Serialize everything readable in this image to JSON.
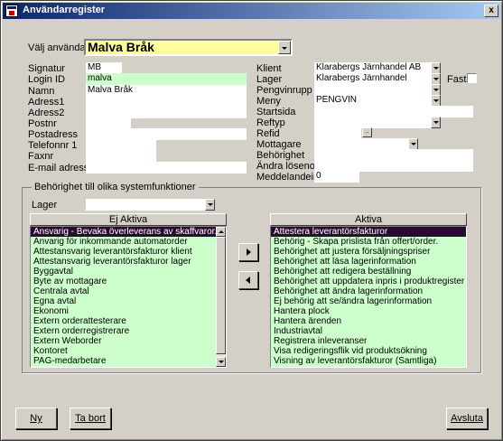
{
  "window": {
    "title": "Användarregister",
    "close_symbol": "x"
  },
  "user_select": {
    "label": "Välj användare",
    "value": "Malva Bråk"
  },
  "left_fields": [
    {
      "label": "Signatur",
      "value": "MB"
    },
    {
      "label": "Login ID",
      "value": "malva"
    },
    {
      "label": "Namn",
      "value": "Malva Bråk"
    },
    {
      "label": "Adress1",
      "value": ""
    },
    {
      "label": "Adress2",
      "value": ""
    },
    {
      "label": "Postnr",
      "value": ""
    },
    {
      "label": "Postadress",
      "value": ""
    },
    {
      "label": "Telefonnr 1",
      "value": ""
    },
    {
      "label": "Faxnr",
      "value": ""
    },
    {
      "label": "E-mail adress",
      "value": ""
    }
  ],
  "right_fields": [
    {
      "label": "Klient",
      "value": "Klarabergs Järnhandel AB"
    },
    {
      "label": "Lager",
      "value": "Klarabergs Järnhandel"
    },
    {
      "label": "Pengvinrupp",
      "value": ""
    },
    {
      "label": "Meny",
      "value": "PENGVIN"
    },
    {
      "label": "Startsida",
      "value": ""
    },
    {
      "label": "Reftyp",
      "value": ""
    },
    {
      "label": "Refid",
      "value": ""
    },
    {
      "label": "Mottagare",
      "value": ""
    },
    {
      "label": "Behörighet",
      "value": ""
    },
    {
      "label": "Ändra lösenord",
      "value": ""
    },
    {
      "label": "Meddelandeint",
      "value": "0"
    }
  ],
  "fast": {
    "label": "Fast",
    "checked": false
  },
  "refid_button": "..",
  "permissions": {
    "legend": "Behörighet till olika systemfunktioner",
    "lager_label": "Lager",
    "lager_value": "",
    "inactive_header": "Ej Aktiva",
    "active_header": "Aktiva",
    "inactive_items": [
      "Ansvarig - Bevaka överleverans av skaffvaror.",
      "Anvarig för inkommande automatorder",
      "Attestansvarig leverantörsfakturor klient",
      "Attestansvarig leverantörsfakturor lager",
      "Byggavtal",
      "Byte av mottagare",
      "Centrala avtal",
      "Egna avtal",
      "Ekonomi",
      "Extern orderattesterare",
      "Extern orderregistrerare",
      "Extern Weborder",
      "Kontoret",
      "PAG-medarbetare"
    ],
    "active_items": [
      "Attestera leverantörsfakturor",
      "Behörig - Skapa prislista från offert/order.",
      "Behörighet att justera försäljningspriser",
      "Behörighet att läsa lagerinformation",
      "Behörighet att redigera beställning",
      "Behörighet att uppdatera inpris i produktregister",
      "Behörighet att ändra lagerinformation",
      "Ej behörig att se/ändra lagerinformation",
      "Hantera plock",
      "Hantera ärenden",
      "Industriavtal",
      "Registrera inleveranser",
      "Visa redigeringsflik vid produktsökning",
      "Visning av leverantörsfakturor (Samtliga)"
    ]
  },
  "buttons": {
    "new": "Ny",
    "delete": "Ta bort",
    "exit": "Avsluta"
  },
  "colors": {
    "green_field": "#ccffcc",
    "yellow_field": "#ffff99",
    "selected_row": "#2a0a30",
    "title_bar": "#0a246a"
  }
}
